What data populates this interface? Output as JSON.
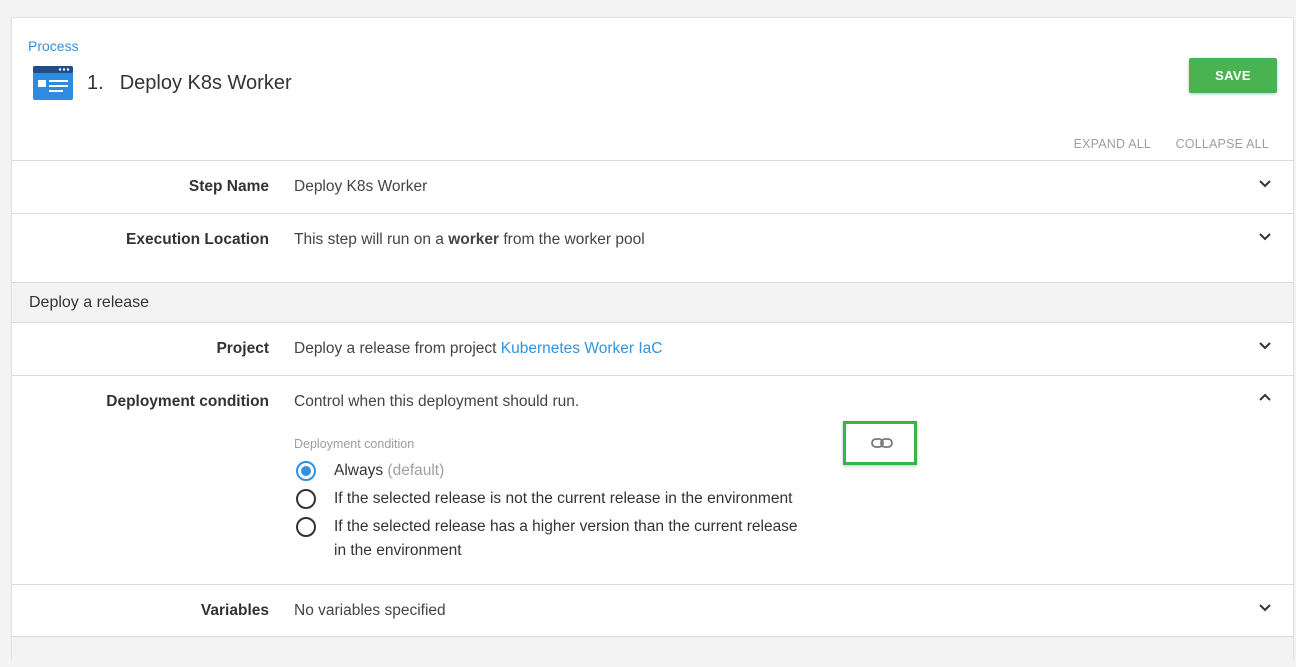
{
  "header": {
    "breadcrumb": "Process",
    "step_number": "1.",
    "title": "Deploy K8s Worker",
    "save_label": "SAVE",
    "expand_all": "EXPAND ALL",
    "collapse_all": "COLLAPSE ALL"
  },
  "rows": {
    "step_name": {
      "label": "Step Name",
      "value": "Deploy K8s Worker"
    },
    "execution_location": {
      "label": "Execution Location",
      "prefix": "This step will run on a ",
      "bold": "worker",
      "suffix": " from the worker pool"
    },
    "section_title": "Deploy a release",
    "project": {
      "label": "Project",
      "prefix": "Deploy a release from project ",
      "link": "Kubernetes Worker IaC"
    },
    "deployment_condition": {
      "label": "Deployment condition",
      "summary": "Control when this deployment should run.",
      "field_caption": "Deployment condition",
      "options": [
        {
          "label": "Always",
          "suffix": " (default)",
          "selected": true
        },
        {
          "label": "If the selected release is not the current release in the environment",
          "selected": false
        },
        {
          "label_line1": "If the selected release has a higher version than the current release",
          "label_line2": "in the environment",
          "selected": false
        }
      ]
    },
    "variables": {
      "label": "Variables",
      "value": "No variables specified"
    }
  },
  "colors": {
    "accent": "#2f93e0",
    "save": "#48b350",
    "highlight": "#37b44a"
  },
  "icons": {
    "title": "browser-window-icon",
    "chevron_down": "chevron-down-icon",
    "chevron_up": "chevron-up-icon",
    "bind": "link-icon"
  }
}
